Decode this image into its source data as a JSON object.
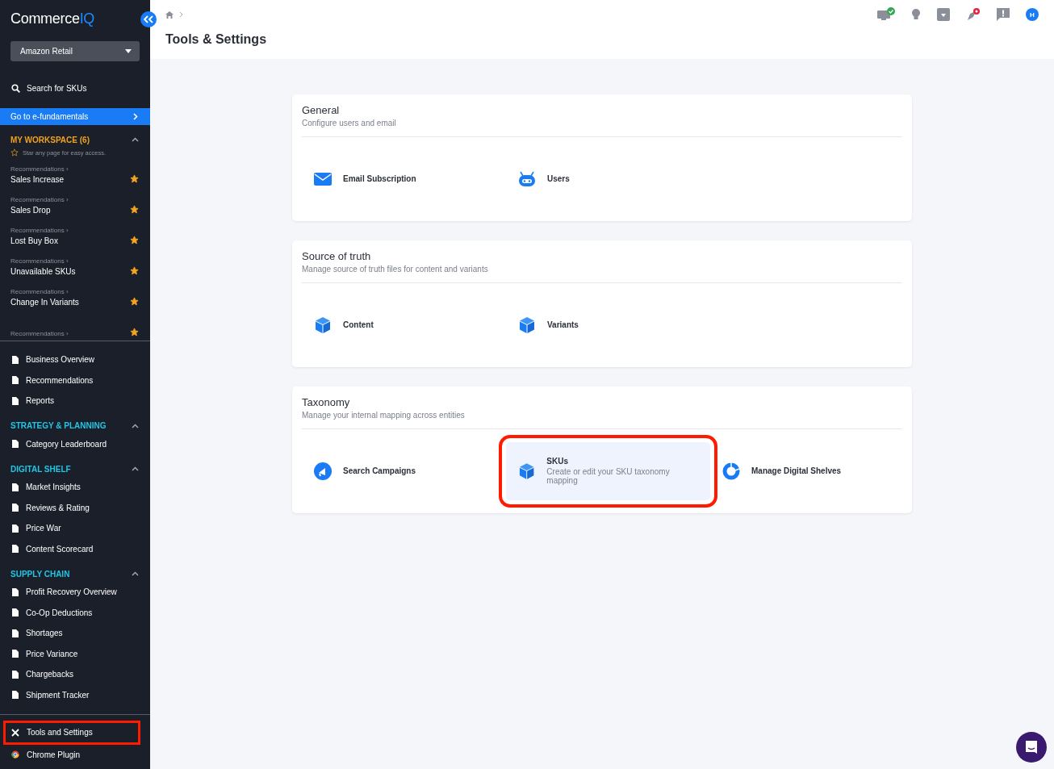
{
  "sidebar": {
    "logo": {
      "main": "Commerce",
      "accent": "IQ"
    },
    "retailer_select": "Amazon Retail",
    "search": "Search for SKUs",
    "promo": "Go to e-fundamentals",
    "workspace": {
      "title": "MY WORKSPACE (6)",
      "expanded": true,
      "hint": "Star any page for easy access.",
      "items": [
        {
          "parent": "Recommendations ›",
          "label": "Sales Increase",
          "starred": true
        },
        {
          "parent": "Recommendations ›",
          "label": "Sales Drop",
          "starred": true
        },
        {
          "parent": "Recommendations ›",
          "label": "Lost Buy Box",
          "starred": true
        },
        {
          "parent": "Recommendations ›",
          "label": "Unavailable SKUs",
          "starred": true
        },
        {
          "parent": "Recommendations ›",
          "label": "Change In Variants",
          "starred": true
        },
        {
          "parent": "Recommendations ›",
          "starred": true
        }
      ]
    },
    "sections": [
      {
        "items": [
          {
            "label": "Business Overview",
            "highlighted": false
          },
          {
            "label": "Recommendations",
            "highlighted": false
          },
          {
            "label": "Reports",
            "highlighted": false
          }
        ]
      },
      {
        "title": "STRATEGY & PLANNING",
        "expanded": true,
        "items": [
          {
            "label": "Category Leaderboard",
            "highlighted": false
          }
        ]
      },
      {
        "title": "DIGITAL SHELF",
        "expanded": true,
        "items": [
          {
            "label": "Market Insights",
            "highlighted": false
          },
          {
            "label": "Reviews & Rating",
            "highlighted": false
          },
          {
            "label": "Price War",
            "highlighted": false
          },
          {
            "label": "Content Scorecard",
            "highlighted": false
          }
        ]
      },
      {
        "title": "SUPPLY CHAIN",
        "expanded": true,
        "items": [
          {
            "label": "Profit Recovery Overview",
            "highlighted": false
          },
          {
            "label": "Co-Op Deductions",
            "highlighted": false
          },
          {
            "label": "Shortages",
            "highlighted": false
          },
          {
            "label": "Price Variance",
            "highlighted": false
          },
          {
            "label": "Chargebacks",
            "highlighted": false
          },
          {
            "label": "Shipment Tracker",
            "highlighted": false
          }
        ]
      }
    ],
    "footer": [
      {
        "label": "Tools and Settings",
        "highlighted": true
      },
      {
        "label": "Chrome Plugin",
        "highlighted": false
      }
    ]
  },
  "header": {
    "title": "Tools & Settings",
    "avatar": "H"
  },
  "cards": [
    {
      "title": "General",
      "subtitle": "Configure users and email",
      "items": [
        {
          "label": "Email Subscription",
          "highlighted": false
        },
        {
          "label": "Users",
          "highlighted": false
        }
      ]
    },
    {
      "title": "Source of truth",
      "subtitle": "Manage source of truth files for content and variants",
      "items": [
        {
          "label": "Content",
          "highlighted": false
        },
        {
          "label": "Variants",
          "highlighted": false
        }
      ]
    },
    {
      "title": "Taxonomy",
      "subtitle": "Manage your internal mapping across entities",
      "items": [
        {
          "label": "Search Campaigns",
          "highlighted": false
        },
        {
          "label": "SKUs",
          "description": "Create or edit your SKU taxonomy mapping",
          "highlighted": true
        },
        {
          "label": "Manage Digital Shelves",
          "highlighted": false
        }
      ]
    }
  ]
}
